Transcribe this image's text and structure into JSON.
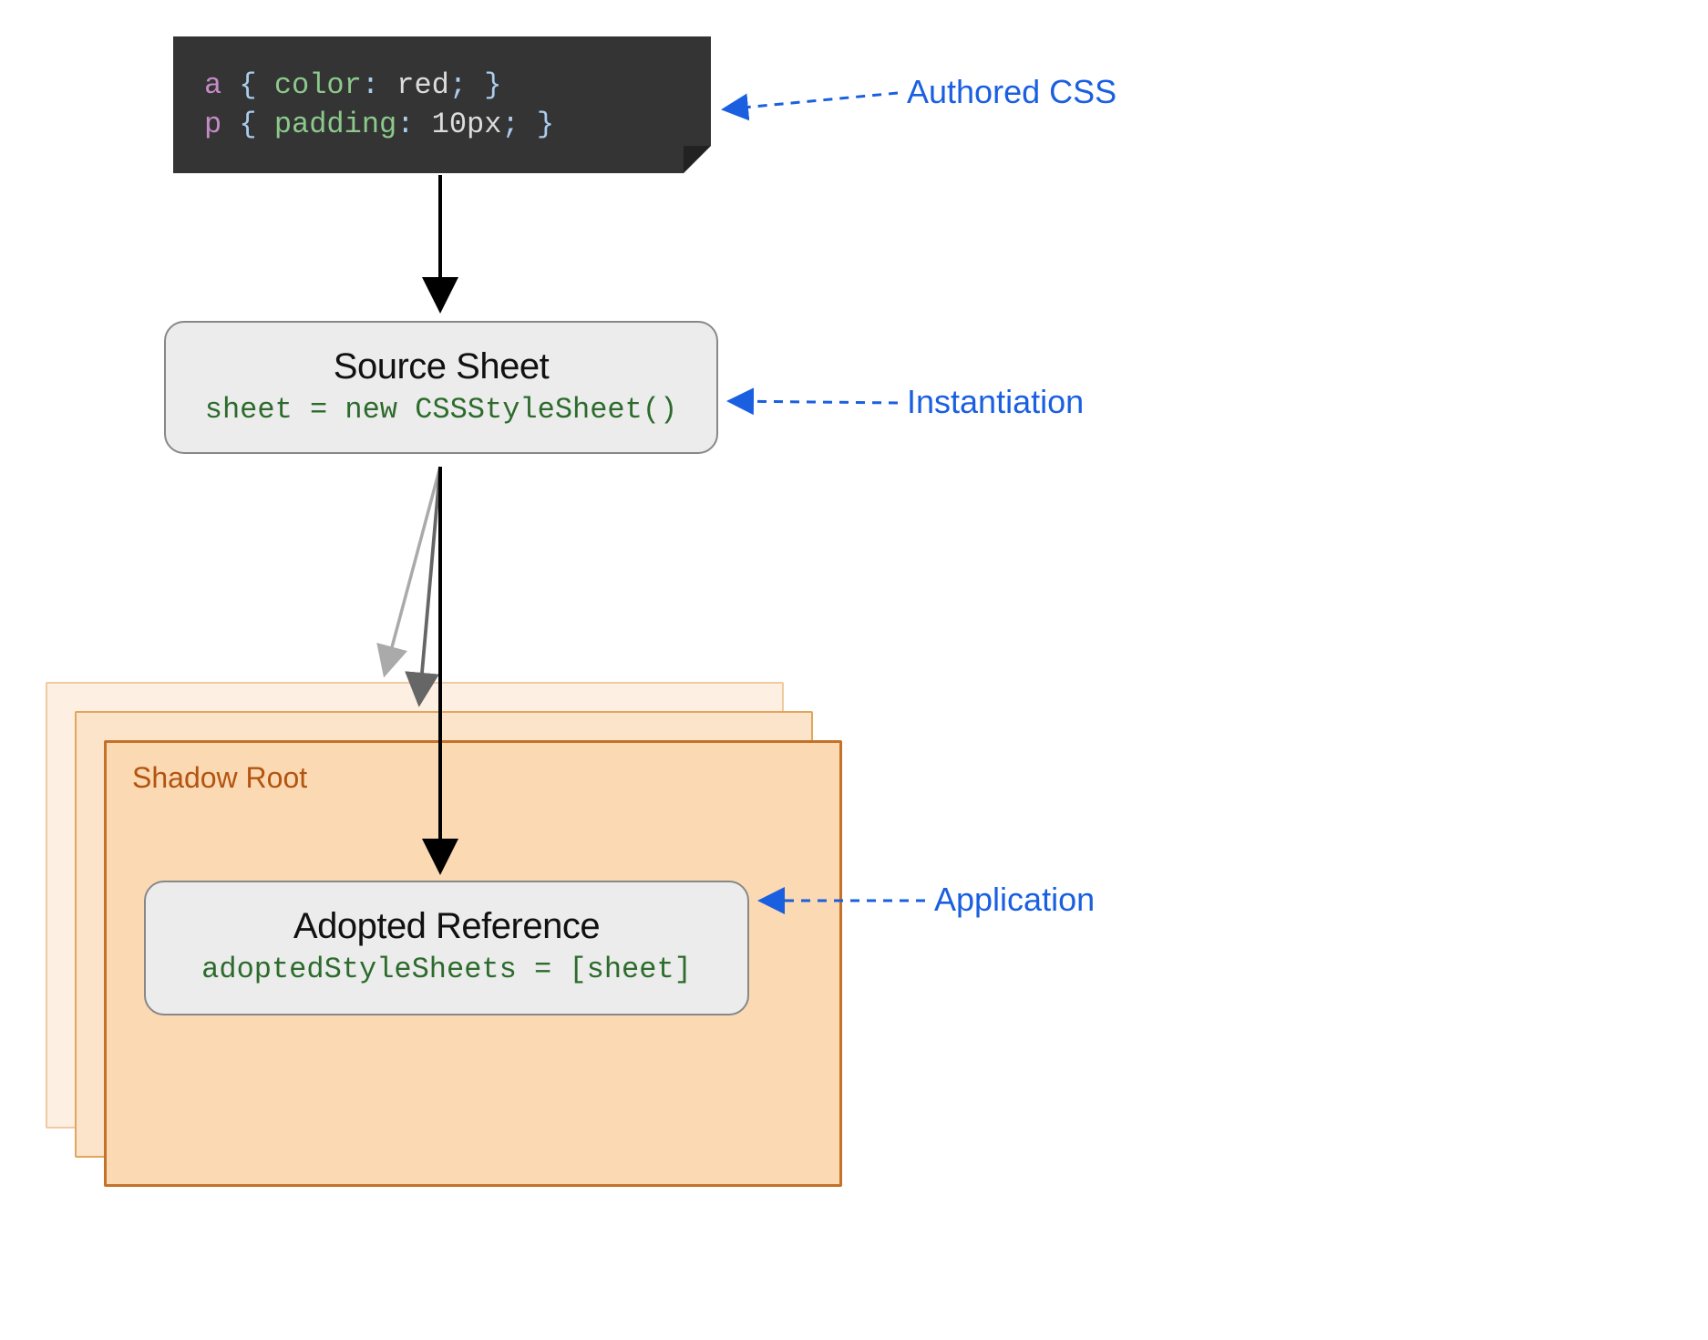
{
  "code": {
    "line1_selector": "a",
    "line1_prop": "color",
    "line1_val": "red",
    "line2_selector": "p",
    "line2_prop": "padding",
    "line2_val": "10px"
  },
  "source_sheet": {
    "title": "Source Sheet",
    "code": "sheet = new CSSStyleSheet()"
  },
  "shadow_root": {
    "label": "Shadow Root"
  },
  "adopted_reference": {
    "title": "Adopted Reference",
    "code": "adoptedStyleSheets = [sheet]"
  },
  "annotations": {
    "authored_css": "Authored CSS",
    "instantiation": "Instantiation",
    "application": "Application"
  }
}
